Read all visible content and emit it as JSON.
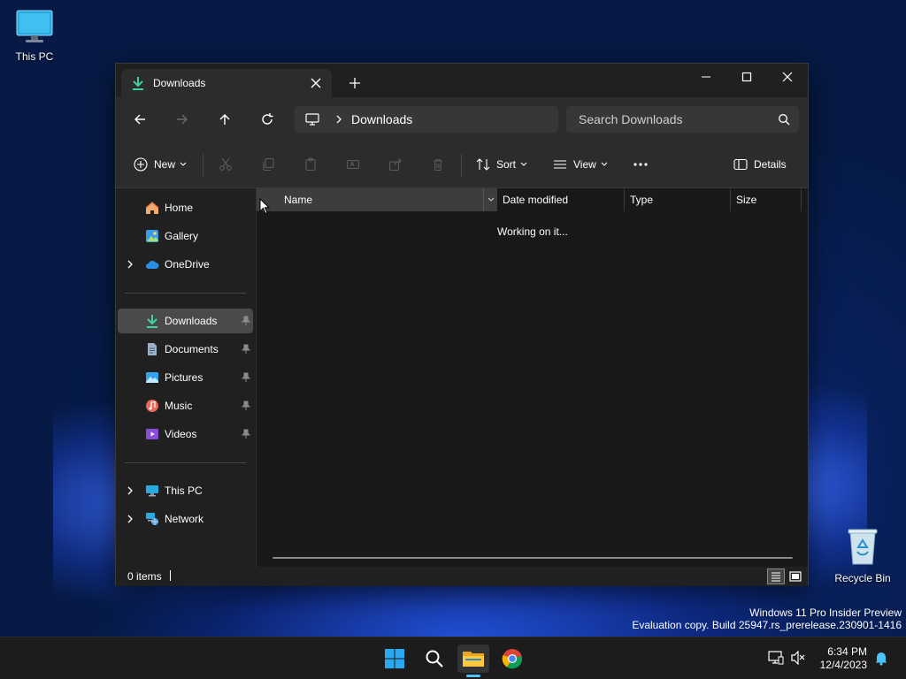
{
  "desktop": {
    "this_pc_label": "This PC",
    "recycle_bin_label": "Recycle Bin"
  },
  "window": {
    "tab": {
      "title": "Downloads",
      "icon": "download-icon"
    },
    "address": {
      "crumb": "Downloads",
      "root_icon": "monitor-icon"
    },
    "search": {
      "placeholder": "Search Downloads"
    },
    "commands": {
      "new_label": "New",
      "sort_label": "Sort",
      "view_label": "View",
      "details_label": "Details"
    },
    "nav": {
      "home": "Home",
      "gallery": "Gallery",
      "onedrive": "OneDrive",
      "downloads": "Downloads",
      "documents": "Documents",
      "pictures": "Pictures",
      "music": "Music",
      "videos": "Videos",
      "this_pc": "This PC",
      "network": "Network"
    },
    "columns": {
      "name": "Name",
      "date_modified": "Date modified",
      "type": "Type",
      "size": "Size"
    },
    "status_message": "Working on it...",
    "status_bar": {
      "item_count": "0 items"
    }
  },
  "watermark": {
    "line1": "Windows 11 Pro Insider Preview",
    "line2": "Evaluation copy. Build 25947.rs_prerelease.230901-1416"
  },
  "taskbar": {
    "time": "6:34 PM",
    "date": "12/4/2023"
  },
  "colors": {
    "accent": "#4cc2ff",
    "window_bg": "#202020",
    "content_bg": "#191919",
    "selected_nav": "#4a4a4a"
  }
}
